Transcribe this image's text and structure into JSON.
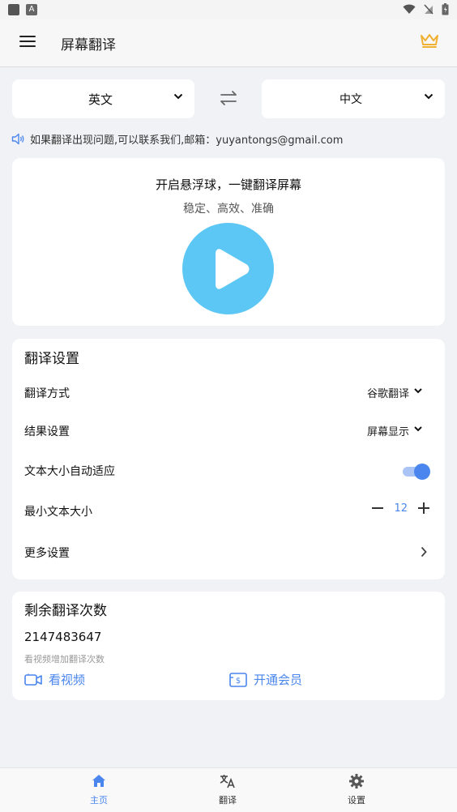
{
  "appbar": {
    "title": "屏幕翻译"
  },
  "languages": {
    "source": "英文",
    "target": "中文"
  },
  "notice": "如果翻译出现问题,可以联系我们,邮箱：yuyantongs@gmail.com",
  "float": {
    "headline": "开启悬浮球，一键翻译屏幕",
    "subline": "稳定、高效、准确"
  },
  "settings": {
    "title": "翻译设置",
    "method_label": "翻译方式",
    "method_value": "谷歌翻译",
    "result_label": "结果设置",
    "result_value": "屏幕显示",
    "autosize_label": "文本大小自动适应",
    "autosize_on": true,
    "minsize_label": "最小文本大小",
    "minsize_value": "12",
    "more_label": "更多设置"
  },
  "remain": {
    "title": "剩余翻译次数",
    "count": "2147483647",
    "hint": "看视频增加翻译次数",
    "watch_video": "看视频",
    "open_vip": "开通会员"
  },
  "nav": {
    "home": "主页",
    "translate": "翻译",
    "settings": "设置",
    "active": "home"
  },
  "colors": {
    "accent": "#4a86ee",
    "play": "#5cc7f5",
    "crown": "#f0b030"
  }
}
